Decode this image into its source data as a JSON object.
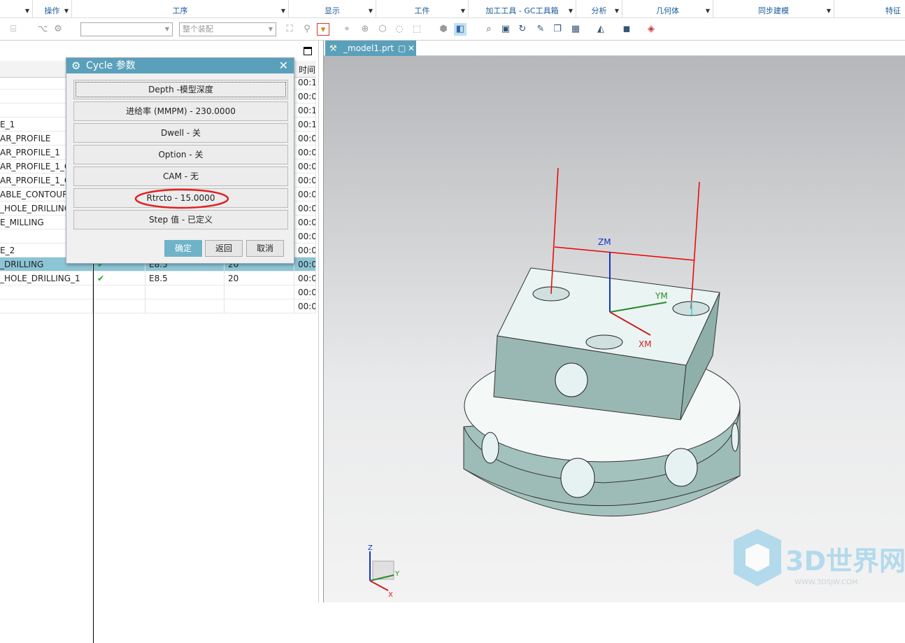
{
  "menubar": {
    "groups": [
      "操作",
      "工序",
      "显示",
      "工件",
      "加工工具 - GC工具箱",
      "分析",
      "几何体",
      "同步建模",
      "特征"
    ]
  },
  "toolbar": {
    "combo1": "",
    "combo2": "整个装配"
  },
  "table": {
    "header_time": "时间",
    "rows": [
      {
        "name": "",
        "check": false,
        "tool": "",
        "col4": "",
        "time": "00:1"
      },
      {
        "name": "",
        "check": false,
        "tool": "",
        "col4": "",
        "time": "00:0"
      },
      {
        "name": "",
        "check": false,
        "tool": "",
        "col4": "",
        "time": "00:1"
      },
      {
        "name": "E_1",
        "check": false,
        "tool": "",
        "col4": "",
        "time": "00:1"
      },
      {
        "name": "AR_PROFILE",
        "check": false,
        "tool": "",
        "col4": "",
        "time": "00:0"
      },
      {
        "name": "AR_PROFILE_1",
        "check": false,
        "tool": "",
        "col4": "",
        "time": "00:0"
      },
      {
        "name": "AR_PROFILE_1_C",
        "check": false,
        "tool": "",
        "col4": "",
        "time": "00:0"
      },
      {
        "name": "AR_PROFILE_1_C",
        "check": false,
        "tool": "",
        "col4": "",
        "time": "00:0"
      },
      {
        "name": "ABLE_CONTOUR",
        "check": false,
        "tool": "",
        "col4": "",
        "time": "00:0"
      },
      {
        "name": "_HOLE_DRILLING",
        "check": false,
        "tool": "",
        "col4": "",
        "time": "00:0"
      },
      {
        "name": "E_MILLING",
        "check": false,
        "tool": "",
        "col4": "",
        "time": "00:0"
      },
      {
        "name": "",
        "check": false,
        "tool": "",
        "col4": "",
        "time": "00:0"
      },
      {
        "name": "E_2",
        "check": false,
        "tool": "",
        "col4": "",
        "time": "00:0"
      },
      {
        "name": "_DRILLING",
        "check": true,
        "tool": "E8.5",
        "col4": "20",
        "time": "00:0",
        "selected": true
      },
      {
        "name": "_HOLE_DRILLING_1",
        "check": true,
        "tool": "E8.5",
        "col4": "20",
        "time": "00:0"
      },
      {
        "name": "",
        "check": false,
        "tool": "",
        "col4": "",
        "time": "00:0"
      },
      {
        "name": "",
        "check": false,
        "tool": "",
        "col4": "",
        "time": "00:0"
      }
    ]
  },
  "dialog": {
    "title": "Cycle 参数",
    "params": [
      "Depth -模型深度",
      "进给率 (MMPM) - 230.0000",
      "Dwell - 关",
      "Option - 关",
      "CAM - 无",
      "Rtrcto - 15.0000",
      "Step 值 - 已定义"
    ],
    "ok": "确定",
    "back": "返回",
    "cancel": "取消",
    "highlight_color": "#e02020"
  },
  "viewport": {
    "tab": "_model1.prt",
    "axes": {
      "zm": "ZM",
      "ym": "YM",
      "xm": "XM"
    },
    "triad": {
      "z": "Z",
      "y": "Y",
      "x": "X"
    },
    "watermark": {
      "brand": "3D世界网",
      "url": "WWW.3DSJW.COM"
    }
  }
}
